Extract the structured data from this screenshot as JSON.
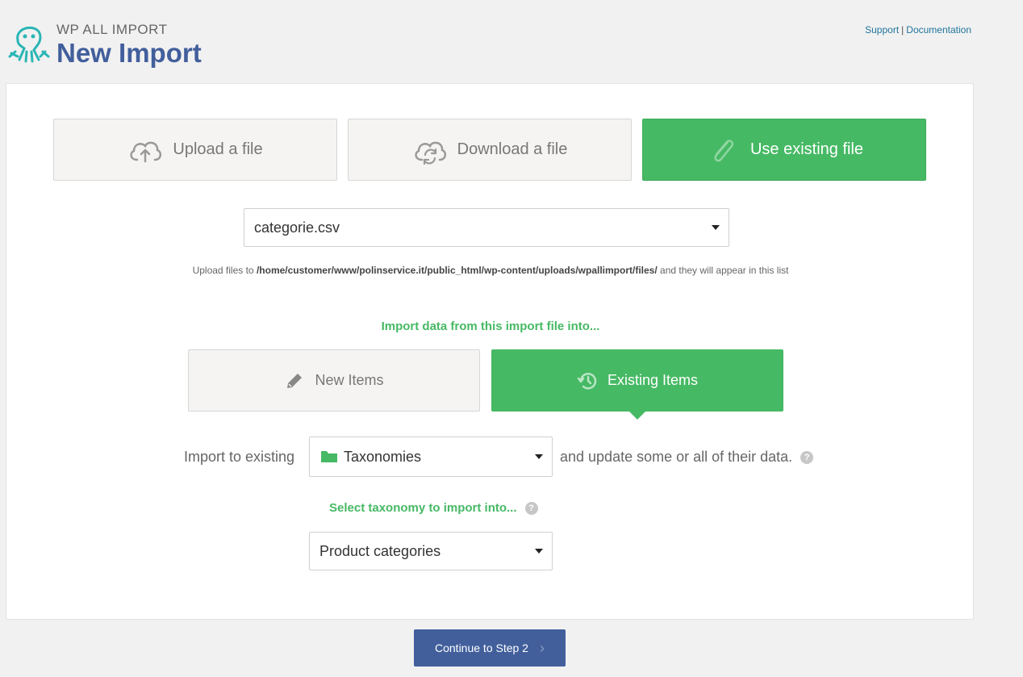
{
  "header": {
    "brand": "WP ALL IMPORT",
    "title": "New Import",
    "links": {
      "support": "Support",
      "separator": "|",
      "documentation": "Documentation"
    }
  },
  "source_tabs": [
    {
      "label": "Upload a file",
      "icon": "cloud-upload-icon",
      "active": false
    },
    {
      "label": "Download a file",
      "icon": "cloud-sync-icon",
      "active": false
    },
    {
      "label": "Use existing file",
      "icon": "paperclip-icon",
      "active": true
    }
  ],
  "file_select": {
    "value": "categorie.csv"
  },
  "upload_hint": {
    "prefix": "Upload files to ",
    "path": "/home/customer/www/polinservice.it/public_html/wp-content/uploads/wpallimport/files/",
    "suffix": " and they will appear in this list"
  },
  "import_into_label": "Import data from this import file into...",
  "item_tabs": [
    {
      "label": "New Items",
      "icon": "pencil-icon",
      "active": false
    },
    {
      "label": "Existing Items",
      "icon": "history-icon",
      "active": true
    }
  ],
  "import_to": {
    "label": "Import to existing",
    "value": "Taxonomies",
    "suffix": "and update some or all of their data."
  },
  "taxonomy": {
    "label": "Select taxonomy to import into...",
    "value": "Product categories"
  },
  "continue_button": {
    "label": "Continue to Step 2"
  },
  "colors": {
    "accent_green": "#46b964",
    "brand_blue": "#425f9c",
    "logo_teal": "#2bb5b5"
  }
}
